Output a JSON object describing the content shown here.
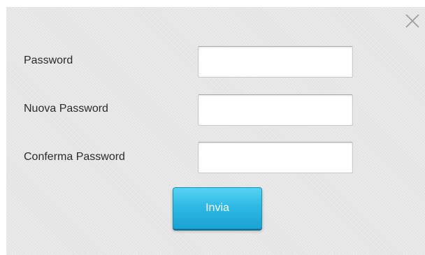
{
  "dialog": {
    "close_icon": "close-icon",
    "fields": [
      {
        "label": "Password",
        "value": ""
      },
      {
        "label": "Nuova Password",
        "value": ""
      },
      {
        "label": "Conferma Password",
        "value": ""
      }
    ],
    "submit_label": "Invia"
  },
  "colors": {
    "dialog_background": "#e4e4e4",
    "button_accent": "#2fb9e4",
    "button_text": "#ffffff",
    "label_text": "#2b2b2b"
  }
}
